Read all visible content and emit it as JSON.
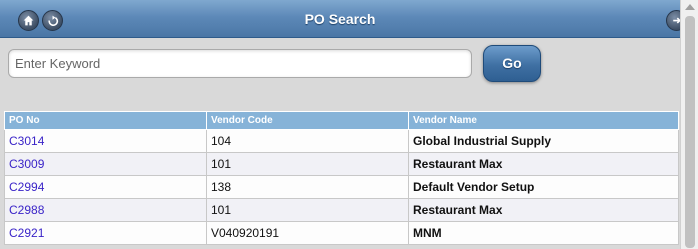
{
  "header": {
    "title": "PO Search"
  },
  "search": {
    "placeholder": "Enter Keyword",
    "value": "",
    "go_label": "Go"
  },
  "table": {
    "columns": [
      "PO No",
      "Vendor Code",
      "Vendor Name"
    ],
    "rows": [
      {
        "po": "C3014",
        "code": "104",
        "name": "Global Industrial Supply"
      },
      {
        "po": "C3009",
        "code": "101",
        "name": "Restaurant Max"
      },
      {
        "po": "C2994",
        "code": "138",
        "name": "Default Vendor Setup"
      },
      {
        "po": "C2988",
        "code": "101",
        "name": "Restaurant Max"
      },
      {
        "po": "C2921",
        "code": "V040920191",
        "name": "MNM"
      }
    ]
  },
  "icons": {
    "home": "home-icon",
    "back": "back-icon",
    "right": "circle-arrow-icon"
  },
  "colors": {
    "header": "#5d89b8",
    "table_header": "#86b3d8",
    "link": "#3a24c8"
  }
}
